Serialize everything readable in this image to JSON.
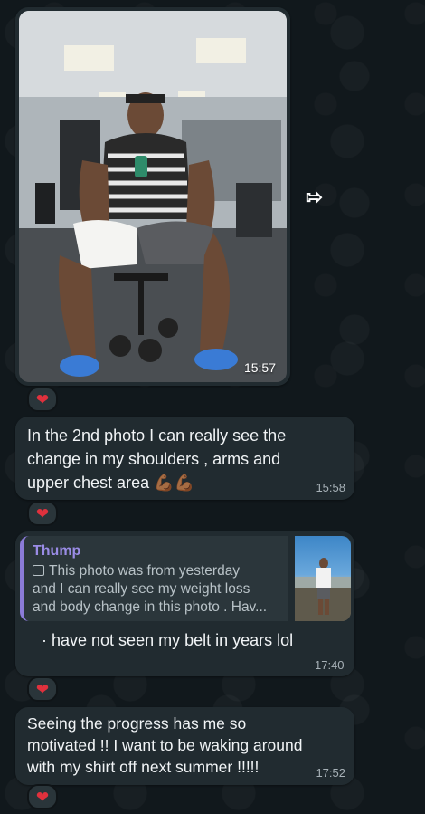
{
  "messages": [
    {
      "type": "photo",
      "time": "15:57",
      "reaction": "❤"
    },
    {
      "type": "text",
      "lines": [
        "In the 2nd photo I can really see the",
        "change in my shoulders , arms and",
        "upper chest area 💪🏾💪🏾"
      ],
      "time": "15:58",
      "reaction": "❤"
    },
    {
      "type": "reply",
      "reply_to": {
        "name": "Thump",
        "lines": [
          "This photo was from yesterday",
          "and I can really see my weight loss",
          "and body change in this photo . Hav..."
        ]
      },
      "text": "· have not seen my belt in years lol",
      "time": "17:40",
      "reaction": "❤"
    },
    {
      "type": "text",
      "lines": [
        "Seeing the progress has me so",
        "motivated !! I want to be waking around",
        "with my shirt off next summer !!!!!"
      ],
      "time": "17:52",
      "reaction": "❤"
    }
  ],
  "icons": {
    "forward": "forward-icon",
    "reaction": "heart-icon",
    "photo_glyph": "photo-icon"
  },
  "colors": {
    "reply_accent": "#8b7bd8",
    "reply_name": "#9a8ce6",
    "heart": "#e0313d",
    "bubble": "#212b30"
  }
}
